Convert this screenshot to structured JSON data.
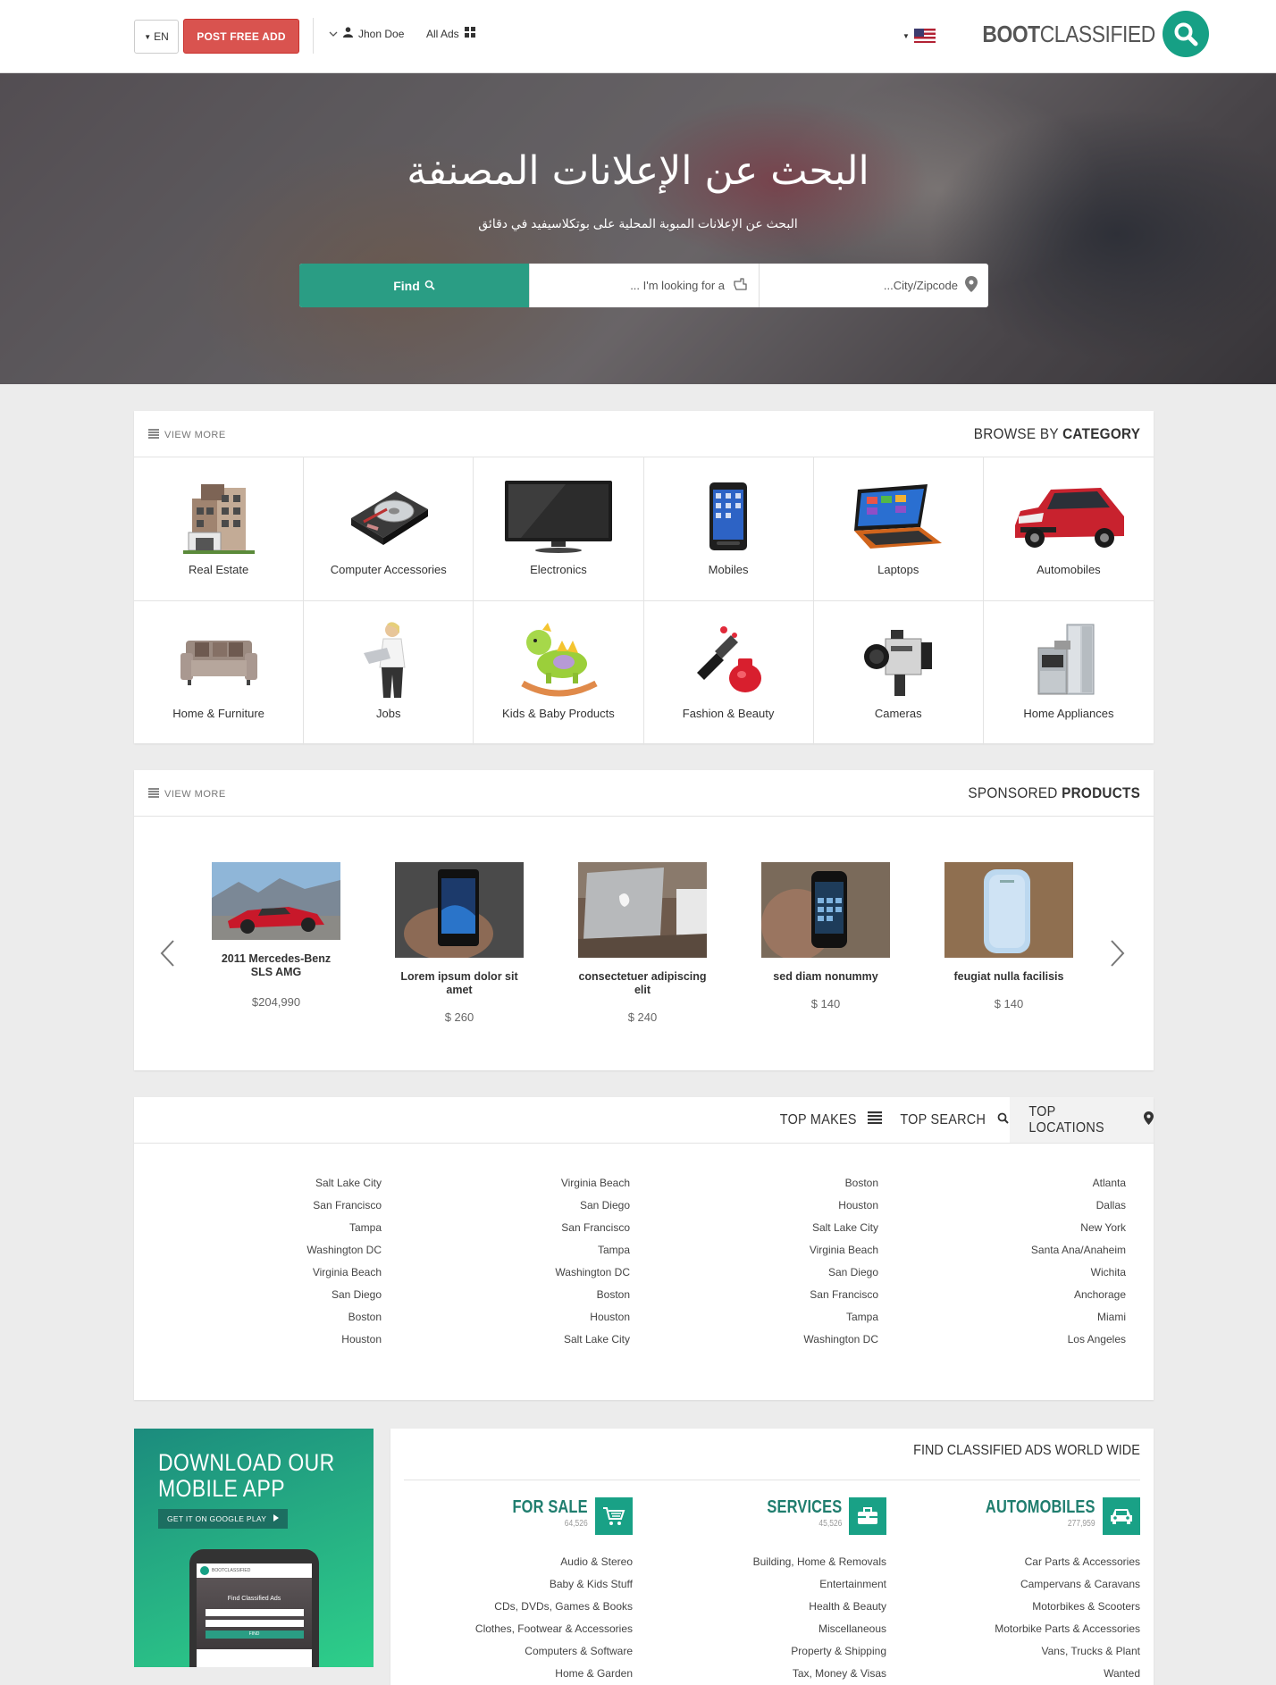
{
  "header": {
    "lang_label": "EN",
    "post_label": "POST FREE ADD",
    "user_label": "Jhon Doe",
    "all_ads_label": "All Ads",
    "logo_bold": "BOOT",
    "logo_light": "CLASSIFIED"
  },
  "hero": {
    "title": "البحث عن الإعلانات المصنفة",
    "subtitle": "البحث عن الإعلانات المبوبة المحلية على بوتكلاسيفيد في دقائق",
    "find_label": "Find",
    "keyword_placeholder": "I'm looking for a ...",
    "location_placeholder": "City/Zipcode..."
  },
  "categories": {
    "view_more": "VIEW MORE",
    "title_light": "BROWSE BY ",
    "title_bold": "CATEGORY",
    "items": [
      {
        "label": "Real Estate",
        "icon": "building-icon"
      },
      {
        "label": "Computer Accessories",
        "icon": "hard-drive-icon"
      },
      {
        "label": "Electronics",
        "icon": "tv-icon"
      },
      {
        "label": "Mobiles",
        "icon": "phone-icon"
      },
      {
        "label": "Laptops",
        "icon": "laptop-icon"
      },
      {
        "label": "Automobiles",
        "icon": "car-icon"
      },
      {
        "label": "Home & Furniture",
        "icon": "sofa-icon"
      },
      {
        "label": "Jobs",
        "icon": "worker-icon"
      },
      {
        "label": "Kids & Baby Products",
        "icon": "rocking-toy-icon"
      },
      {
        "label": "Fashion & Beauty",
        "icon": "nail-polish-icon"
      },
      {
        "label": "Cameras",
        "icon": "camera-icon"
      },
      {
        "label": "Home Appliances",
        "icon": "fridge-icon"
      }
    ]
  },
  "sponsored": {
    "view_more": "VIEW MORE",
    "title_light": "SPONSORED ",
    "title_bold": "PRODUCTS",
    "products": [
      {
        "title": "2011 Mercedes-Benz SLS AMG",
        "price": "$204,990"
      },
      {
        "title": "Lorem ipsum dolor sit amet",
        "price": "$ 260"
      },
      {
        "title": "consectetuer adipiscing elit",
        "price": "$ 240"
      },
      {
        "title": "sed diam nonummy",
        "price": "$ 140"
      },
      {
        "title": "feugiat nulla facilisis",
        "price": "$ 140"
      }
    ]
  },
  "top_tabs": {
    "makes": "TOP MAKES",
    "search": "TOP SEARCH",
    "locations": "TOP LOCATIONS",
    "columns": [
      [
        "Salt Lake City",
        "San Francisco",
        "Tampa",
        "Washington DC",
        "Virginia Beach",
        "San Diego",
        "Boston",
        "Houston"
      ],
      [
        "Virginia Beach",
        "San Diego",
        "San Francisco",
        "Tampa",
        "Washington DC",
        "Boston",
        "Houston",
        "Salt Lake City"
      ],
      [
        "Boston",
        "Houston",
        "Salt Lake City",
        "Virginia Beach",
        "San Diego",
        "San Francisco",
        "Tampa",
        "Washington DC"
      ],
      [
        "Atlanta",
        "Dallas",
        "New York",
        "Santa Ana/Anaheim",
        "Wichita",
        "Anchorage",
        "Miami",
        "Los Angeles"
      ]
    ]
  },
  "app_promo": {
    "title_line1": "DOWNLOAD OUR",
    "title_line2": "MOBILE APP",
    "button": "GET IT ON GOOGLE PLAY",
    "phone_logo": "BOOTCLASSIFIED",
    "phone_tagline": "Find Classified Ads",
    "phone_find": "FIND"
  },
  "worldwide": {
    "title": "FIND CLASSIFIED ADS WORLD WIDE",
    "columns": [
      {
        "name": "FOR SALE",
        "count": "64,526",
        "icon": "cart-icon",
        "items": [
          "Audio & Stereo",
          "Baby & Kids Stuff",
          "CDs, DVDs, Games & Books",
          "Clothes, Footwear & Accessories",
          "Computers & Software",
          "Home & Garden"
        ]
      },
      {
        "name": "SERVICES",
        "count": "45,526",
        "icon": "briefcase-icon",
        "items": [
          "Building, Home & Removals",
          "Entertainment",
          "Health & Beauty",
          "Miscellaneous",
          "Property & Shipping",
          "Tax, Money & Visas"
        ]
      },
      {
        "name": "AUTOMOBILES",
        "count": "277,959",
        "icon": "car-icon",
        "items": [
          "Car Parts & Accessories",
          "Campervans & Caravans",
          "Motorbikes & Scooters",
          "Motorbike Parts & Accessories",
          "Vans, Trucks & Plant",
          "Wanted"
        ]
      }
    ]
  },
  "colors": {
    "accent": "#2a9d84",
    "danger": "#d9534f",
    "brand_dark": "#1f7d6e"
  }
}
